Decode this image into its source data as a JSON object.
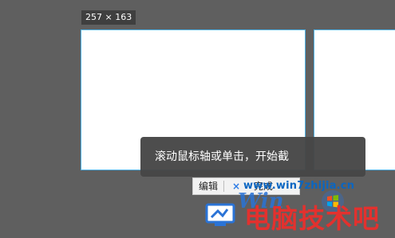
{
  "screenshot": {
    "size_label": "257 × 163"
  },
  "tooltip": {
    "text": "滚动鼠标轴或单击，开始截"
  },
  "toolbar": {
    "edit_label": "编辑",
    "close_label": "×",
    "done_label": "完成"
  },
  "watermark": {
    "url": "www.win7zhijia.cn",
    "brand": "Win",
    "title": "电脑技术吧"
  },
  "colors": {
    "selection_border": "#4fb0e6",
    "watermark_red": "#e3312e",
    "watermark_blue": "#0a66c2"
  }
}
